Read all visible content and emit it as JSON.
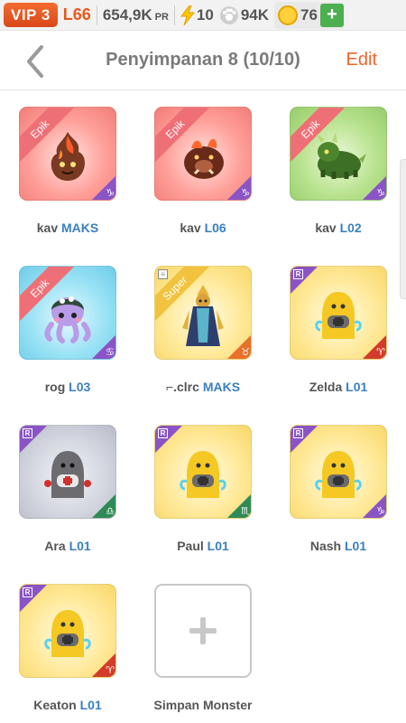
{
  "status": {
    "vip": "VIP 3",
    "level": "L66",
    "power": "654,9K",
    "power_unit": "PR",
    "energy": "10",
    "paw": "94K",
    "coins": "76",
    "plus": "+"
  },
  "header": {
    "title": "Penyimpanan 8 (10/10)",
    "edit": "Edit"
  },
  "monsters": [
    {
      "name": "kav",
      "level": "MAKS",
      "rarity": "Epik",
      "zodiac": "♑",
      "color": "red"
    },
    {
      "name": "kav",
      "level": "L06",
      "rarity": "Epik",
      "zodiac": "♑",
      "color": "red"
    },
    {
      "name": "kav",
      "level": "L02",
      "rarity": "Epik",
      "zodiac": "♑",
      "color": "green"
    },
    {
      "name": "rog",
      "level": "L03",
      "rarity": "Epik",
      "zodiac": "♋",
      "color": "blue"
    },
    {
      "name": "⌐.clrc",
      "level": "MAKS",
      "rarity": "Super",
      "zodiac": "♉",
      "color": "yellow"
    },
    {
      "name": "Zelda",
      "level": "L01",
      "rarity": "R",
      "zodiac": "♈",
      "color": "yellow"
    },
    {
      "name": "Ara",
      "level": "L01",
      "rarity": "R",
      "zodiac": "♎",
      "color": "grey"
    },
    {
      "name": "Paul",
      "level": "L01",
      "rarity": "R",
      "zodiac": "♏",
      "color": "yellow"
    },
    {
      "name": "Nash",
      "level": "L01",
      "rarity": "R",
      "zodiac": "♑",
      "color": "yellow"
    },
    {
      "name": "Keaton",
      "level": "L01",
      "rarity": "R",
      "zodiac": "♈",
      "color": "yellow"
    }
  ],
  "add_slot": {
    "label": "Simpan Monster",
    "icon": "plus-icon"
  },
  "colors": {
    "accent": "#f0642a",
    "level_blue": "#3b7fbf",
    "vip": "#e55a1c"
  }
}
